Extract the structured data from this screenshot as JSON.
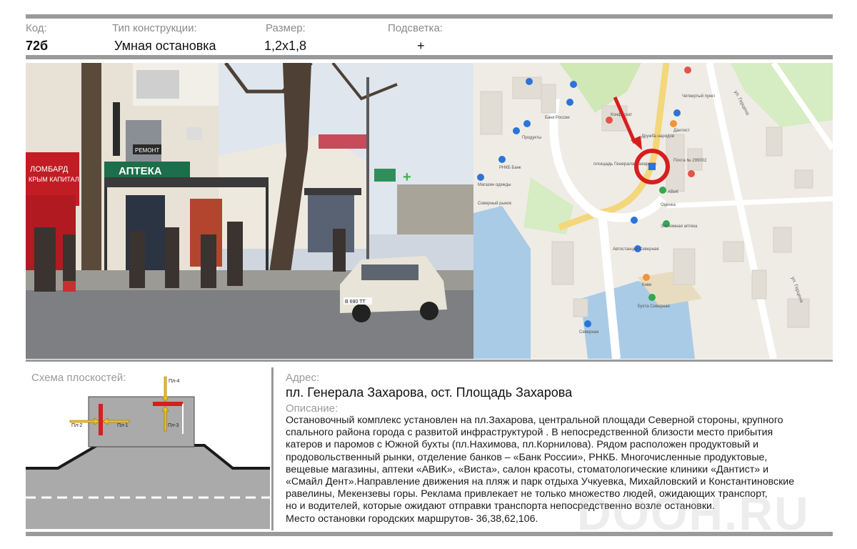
{
  "header": {
    "code_label": "Код:",
    "code_value": "72б",
    "type_label": "Тип конструкции:",
    "type_value": "Умная остановка",
    "size_label": "Размер:",
    "size_value": "1,2х1,8",
    "light_label": "Подсветка:",
    "light_value": "+"
  },
  "photo": {
    "shop_lombard": "ЛОМБАРД",
    "shop_krym": "КРЫМ КАПИТАЛ",
    "shop_apteka": "АПТЕКА",
    "shop_remont": "РЕМОНТ",
    "plate": "В 690 ТТ"
  },
  "map": {
    "square_label": "площадь Генерала Захарова",
    "street_gertsena_1": "ул. Герцена",
    "street_gertsena_2": "ул. Герцена",
    "poi": [
      "Конфискат",
      "Банк России",
      "РНКБ Банк",
      "Продукты",
      "Магазин одежды",
      "Северный рынок",
      "Дантист",
      "Почта № 299002",
      "Дружба народов",
      "АВиК",
      "Оценка",
      "Экономная аптека",
      "Автостанция Северная",
      "Киви",
      "Бухта Северная",
      "Северная",
      "Четвертый пункт"
    ]
  },
  "scheme": {
    "title": "Схема плоскостей:",
    "p1": "Пл-1",
    "p2": "Пл-2",
    "p3": "Пл-3",
    "p4": "Пл-4"
  },
  "address": {
    "label": "Адрес:",
    "value": "пл. Генерала Захарова, ост. Площадь Захарова"
  },
  "description": {
    "label": "Описание:",
    "lines": [
      "Остановочный комплекс установлен на пл.Захарова, центральной площади Северной стороны,  крупного",
      "спального района города  с развитой инфраструктурой  . В непосредственной близости место прибытия",
      "катеров и паромов с Южной бухты (пл.Нахимова, пл.Корнилова). Рядом  расположен  продуктовый и",
      "продовольственный рынки, отделение банков – «Банк России», РНКБ. Многочисленные продуктовые,",
      "вещевые магазины, аптеки «АВиК», «Виста»,   салон красоты, стоматологические клиники  «Дантист» и",
      "«Смайл Дент».Направление движения на пляж и парк отдыха Учкуевка, Михайловский и Константиновские",
      "равелины, Мекензевы горы. Реклама привлекает не только множество людей, ожидающих транспорт,",
      "но и водителей, которые ожидают отправки транспорта непосредственно возле остановки.",
      "Место остановки городских маршрутов- 36,38,62,106."
    ]
  },
  "watermark": "DOOH.RU",
  "colors": {
    "rule": "#9a9a9a",
    "panel_red": "#d32020",
    "arrow_yellow": "#f2c218",
    "road": "#aaaaaa"
  }
}
